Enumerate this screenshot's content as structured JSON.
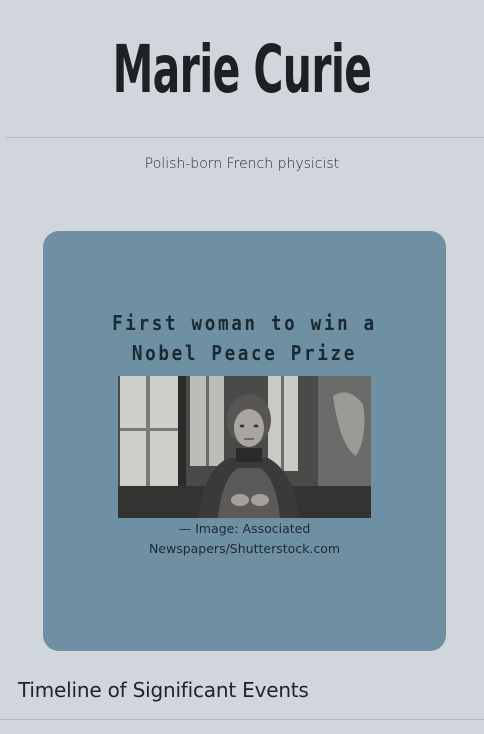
{
  "header": {
    "title": "Marie Curie",
    "subtitle": "Polish-born French physicist"
  },
  "feature_card": {
    "heading_line1": "First woman to win a",
    "heading_line2": "Nobel Peace Prize",
    "image_caption": "—  Image: Associated Newspapers/Shutterstock.com",
    "card_color": "#6f8fa3"
  },
  "timeline": {
    "heading": "Timeline of Significant Events"
  }
}
